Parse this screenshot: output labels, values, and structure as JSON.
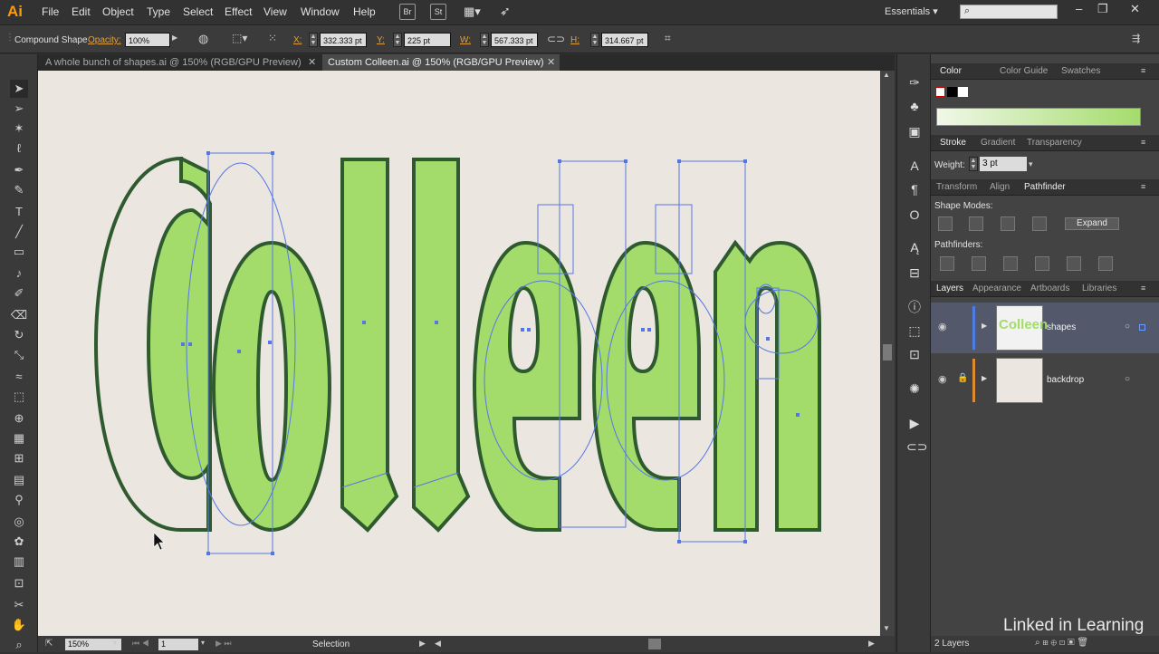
{
  "app": {
    "logo": "Ai",
    "menus": [
      "File",
      "Edit",
      "Object",
      "Type",
      "Select",
      "Effect",
      "View",
      "Window",
      "Help"
    ],
    "bridge": "Br",
    "stock": "St",
    "workspace": "Essentials"
  },
  "control": {
    "object_type": "Compound Shape",
    "opacity_label": "Opacity:",
    "opacity": "100%",
    "x_label": "X:",
    "x": "332.333 pt",
    "y_label": "Y:",
    "y": "225 pt",
    "w_label": "W:",
    "w": "567.333 pt",
    "h_label": "H:",
    "h": "314.667 pt"
  },
  "tabs": [
    {
      "label": "A whole bunch of shapes.ai @ 150% (RGB/GPU Preview)",
      "active": false
    },
    {
      "label": "Custom Colleen.ai @ 150% (RGB/GPU Preview)",
      "active": true
    }
  ],
  "status": {
    "zoom": "150%",
    "artboard": "1",
    "tool": "Selection"
  },
  "panels": {
    "color_tabs": [
      "Color",
      "Color Guide",
      "Swatches"
    ],
    "stroke_tabs": [
      "Stroke",
      "Gradient",
      "Transparency"
    ],
    "weight_label": "Weight:",
    "weight": "3 pt",
    "pathfinder_tabs": [
      "Transform",
      "Align",
      "Pathfinder"
    ],
    "shape_modes": "Shape Modes:",
    "expand": "Expand",
    "pathfinders": "Pathfinders:",
    "layers_tabs": [
      "Layers",
      "Appearance",
      "Artboards",
      "Libraries"
    ],
    "layers": [
      {
        "name": "shapes",
        "thumb": "Colleen",
        "selected": true
      },
      {
        "name": "backdrop",
        "selected": false
      }
    ],
    "count": "2 Layers"
  },
  "colors": {
    "letter_fill": "#a4dc6c",
    "letter_stroke": "#2f5a2f",
    "selection": "#5577e6",
    "canvas": "#ebe6df"
  },
  "watermark": "Linked in Learning"
}
